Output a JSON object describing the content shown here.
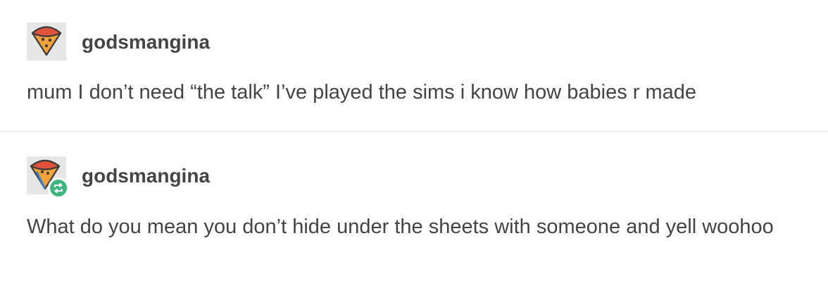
{
  "posts": [
    {
      "username": "godsmangina",
      "avatar_icon": "pizza-slice-icon",
      "text": "mum I don’t need “the talk” I’ve played the sims i know how babies r made"
    },
    {
      "username": "godsmangina",
      "avatar_icon": "pizza-slice-icon",
      "badge_icon": "reblog-icon",
      "text": "What do you mean you don’t hide under the sheets with someone and yell woohoo"
    }
  ],
  "colors": {
    "text": "#444444",
    "avatar_bg": "#e6e6e6",
    "reblog_badge": "#3fb57f",
    "divider": "#e2e2e2"
  }
}
